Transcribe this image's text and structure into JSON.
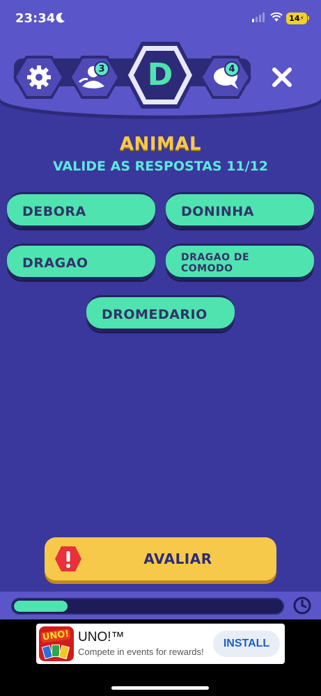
{
  "status": {
    "time": "23:34",
    "battery": "14"
  },
  "header": {
    "letter": "D",
    "players_count": "3",
    "chat_count": "4"
  },
  "round": {
    "category": "ANIMAL",
    "instruction": "VALIDE AS RESPOSTAS 11/12"
  },
  "answers": [
    {
      "label": "DEBORA"
    },
    {
      "label": "DONINHA"
    },
    {
      "label": "DRAGAO"
    },
    {
      "label": "DRAGAO DE\nCOMODO"
    },
    {
      "label": "DROMEDARIO"
    }
  ],
  "action": {
    "label": "AVALIAR"
  },
  "timer": {
    "progress": 0.2
  },
  "ad": {
    "logo_text": "UNO!",
    "title": "UNO!™",
    "subtitle": "Compete in events for rewards!",
    "button": "INSTALL"
  },
  "colors": {
    "background": "#3a389c",
    "header": "#5a55c8",
    "answer": "#4fe3b0",
    "accent_yellow": "#f7c94a",
    "accent_cyan": "#5de8e0",
    "warning_red": "#e8313a"
  },
  "icons": [
    "moon-icon",
    "signal-icon",
    "wifi-icon",
    "gear-icon",
    "players-icon",
    "letter-hexagon",
    "chat-icon",
    "close-icon",
    "warning-icon",
    "clock-icon"
  ]
}
